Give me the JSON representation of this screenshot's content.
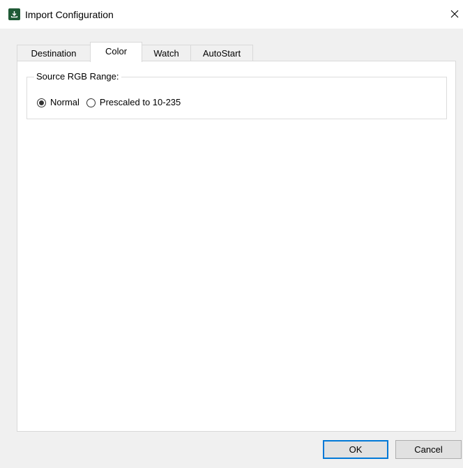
{
  "window": {
    "title": "Import Configuration",
    "icon": "import-app-icon",
    "close_icon": "close-icon"
  },
  "tabs": [
    {
      "label": "Destination",
      "active": false
    },
    {
      "label": "Color",
      "active": true
    },
    {
      "label": "Watch",
      "active": false
    },
    {
      "label": "AutoStart",
      "active": false
    }
  ],
  "color_tab": {
    "group_label": "Source RGB Range:",
    "options": [
      {
        "label": "Normal",
        "selected": true
      },
      {
        "label": "Prescaled to 10-235",
        "selected": false
      }
    ]
  },
  "footer": {
    "ok_label": "OK",
    "cancel_label": "Cancel"
  },
  "colors": {
    "accent": "#0078d7",
    "icon_bg": "#1f5a36"
  }
}
